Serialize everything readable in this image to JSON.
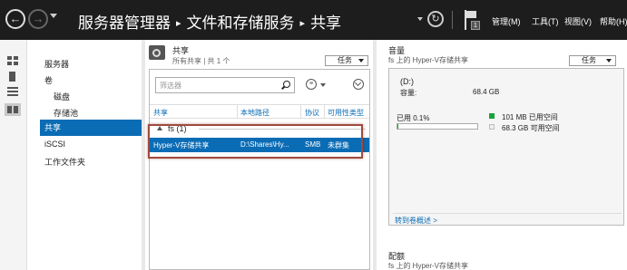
{
  "header": {
    "breadcrumb": [
      "服务器管理器",
      "文件和存储服务",
      "共享"
    ],
    "breadcrumb_separator": "▸",
    "menus": [
      "管理(M)",
      "工具(T)",
      "视图(V)",
      "帮助(H)"
    ],
    "notification_count": "1"
  },
  "nav": {
    "items": [
      {
        "label": "服务器"
      },
      {
        "label": "卷"
      },
      {
        "label": "磁盘"
      },
      {
        "label": "存储池"
      },
      {
        "label": "共享"
      },
      {
        "label": "iSCSI"
      },
      {
        "label": "工作文件夹"
      }
    ],
    "selected": "共享"
  },
  "shares": {
    "title": "共享",
    "subtitle": "所有共享 | 共 1 个",
    "tasks_label": "任务",
    "filter_placeholder": "筛选器",
    "columns": [
      "共享",
      "本地路径",
      "协议",
      "可用性类型"
    ],
    "group_label": "fs (1)",
    "rows": [
      {
        "share": "Hyper-V存储共享",
        "path": "D:\\Shares\\Hy...",
        "protocol": "SMB",
        "availability": "未群集"
      }
    ]
  },
  "volume": {
    "title": "音量",
    "subtitle": "fs 上的 Hyper-V存储共享",
    "tasks_label": "任务",
    "drive": "(D:)",
    "capacity_label": "容量:",
    "capacity_value": "68.4 GB",
    "used_label": "已用 0.1%",
    "used_fraction": 0.001,
    "used_space": "101 MB 已用空间",
    "free_space": "68.3 GB 可用空间",
    "used_color": "#19a33a",
    "free_color": "#f0f0f0",
    "link": "转到卷概述 >"
  },
  "quota": {
    "title": "配额",
    "subtitle": "fs 上的 Hyper-V存储共享"
  },
  "colors": {
    "accent": "#0a6cb5",
    "titlebar": "#1d1d1d",
    "highlight_border": "#a04a3e"
  }
}
